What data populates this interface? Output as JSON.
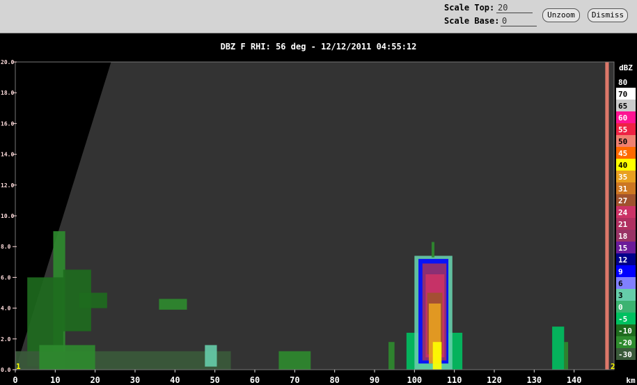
{
  "toolbar": {
    "scale_top_label": "Scale Top:",
    "scale_top_value": "20",
    "scale_base_label": "Scale Base:",
    "scale_base_value": "0",
    "unzoom_label": "Unzoom",
    "dismiss_label": "Dismiss"
  },
  "plot_title": "DBZ F  RHI: 56 deg  -  12/12/2011 04:55:12",
  "chart_data": {
    "type": "heatmap",
    "title": "DBZ F  RHI: 56 deg  -  12/12/2011 04:55:12",
    "x_axis": {
      "unit_label": "km",
      "range": [
        0,
        150
      ],
      "ticks": [
        "0",
        "10",
        "20",
        "30",
        "40",
        "50",
        "60",
        "70",
        "80",
        "90",
        "100",
        "110",
        "120",
        "130",
        "140"
      ]
    },
    "y_axis": {
      "range": [
        0,
        20
      ],
      "ticks": [
        "0.0",
        "2.0",
        "4.0",
        "6.0",
        "8.0",
        "10.0",
        "12.0",
        "14.0",
        "16.0",
        "18.0",
        "20.0"
      ]
    },
    "markers": {
      "left": "1",
      "right": "2"
    },
    "colorbar": {
      "title": "dBZ",
      "entries": [
        {
          "label": "80",
          "color": "#000000"
        },
        {
          "label": "70",
          "color": "#ffffff"
        },
        {
          "label": "65",
          "color": "#cccccc"
        },
        {
          "label": "60",
          "color": "#ff1493"
        },
        {
          "label": "55",
          "color": "#ee2244"
        },
        {
          "label": "50",
          "color": "#f08070"
        },
        {
          "label": "45",
          "color": "#ff6a00"
        },
        {
          "label": "40",
          "color": "#ffff00"
        },
        {
          "label": "35",
          "color": "#e8a020"
        },
        {
          "label": "31",
          "color": "#cc7722"
        },
        {
          "label": "27",
          "color": "#a0522d"
        },
        {
          "label": "24",
          "color": "#cc3366"
        },
        {
          "label": "21",
          "color": "#b03060"
        },
        {
          "label": "18",
          "color": "#993366"
        },
        {
          "label": "15",
          "color": "#6a1b9a"
        },
        {
          "label": "12",
          "color": "#00008b"
        },
        {
          "label": "9",
          "color": "#0000ff"
        },
        {
          "label": "6",
          "color": "#8080ff"
        },
        {
          "label": "3",
          "color": "#66cdaa"
        },
        {
          "label": "0",
          "color": "#3cb371"
        },
        {
          "label": "-5",
          "color": "#00c060"
        },
        {
          "label": "-10",
          "color": "#1e6b1e"
        },
        {
          "label": "-20",
          "color": "#2e8b2e"
        },
        {
          "label": "-30",
          "color": "#3a5a3a"
        }
      ]
    },
    "cells": [
      {
        "x": 0.0,
        "x2": 24.0,
        "y": 0.0,
        "y2": 20.0,
        "shape": "blind_wedge",
        "color": "#000000"
      },
      {
        "x": 9.5,
        "x2": 12.5,
        "y": 0.0,
        "y2": 9.0,
        "color": "#2e8b2e"
      },
      {
        "x": 3.0,
        "x2": 12.0,
        "y": 0.2,
        "y2": 6.0,
        "color": "#1e6b1e"
      },
      {
        "x": 12.0,
        "x2": 19.0,
        "y": 2.5,
        "y2": 6.5,
        "color": "#1e6b1e"
      },
      {
        "x": 16.0,
        "x2": 23.0,
        "y": 4.0,
        "y2": 5.0,
        "color": "#1e6b1e"
      },
      {
        "x": 36.0,
        "x2": 43.0,
        "y": 3.9,
        "y2": 4.6,
        "color": "#2e8b2e"
      },
      {
        "x": 0.0,
        "x2": 54.0,
        "y": 0.0,
        "y2": 1.2,
        "color": "#3a5a3a"
      },
      {
        "x": 6.0,
        "x2": 20.0,
        "y": 0.0,
        "y2": 1.6,
        "color": "#2e8b2e"
      },
      {
        "x": 47.5,
        "x2": 50.5,
        "y": 0.2,
        "y2": 1.6,
        "color": "#66cdaa"
      },
      {
        "x": 66.0,
        "x2": 74.0,
        "y": 0.0,
        "y2": 1.2,
        "color": "#2e8b2e"
      },
      {
        "x": 93.5,
        "x2": 95.0,
        "y": 0.0,
        "y2": 1.8,
        "color": "#2e8b2e"
      },
      {
        "x": 98.0,
        "x2": 112.0,
        "y": 0.0,
        "y2": 2.4,
        "color": "#00c060"
      },
      {
        "x": 100.0,
        "x2": 109.5,
        "y": 0.0,
        "y2": 7.4,
        "color": "#66cdaa"
      },
      {
        "x": 101.0,
        "x2": 108.5,
        "y": 0.4,
        "y2": 7.2,
        "color": "#0000ff"
      },
      {
        "x": 102.0,
        "x2": 108.0,
        "y": 0.6,
        "y2": 6.9,
        "color": "#993366"
      },
      {
        "x": 102.8,
        "x2": 107.5,
        "y": 0.8,
        "y2": 6.2,
        "color": "#cc3366"
      },
      {
        "x": 103.2,
        "x2": 107.0,
        "y": 1.0,
        "y2": 5.0,
        "color": "#a0522d"
      },
      {
        "x": 103.6,
        "x2": 106.6,
        "y": 0.4,
        "y2": 4.3,
        "color": "#e8a020"
      },
      {
        "x": 104.6,
        "x2": 106.8,
        "y": 0.0,
        "y2": 1.8,
        "color": "#ffff00"
      },
      {
        "x": 104.3,
        "x2": 105.0,
        "y": 7.3,
        "y2": 8.3,
        "color": "#2e8b2e"
      },
      {
        "x": 134.5,
        "x2": 137.5,
        "y": 0.0,
        "y2": 2.8,
        "color": "#00c060"
      },
      {
        "x": 137.5,
        "x2": 138.5,
        "y": 0.0,
        "y2": 1.8,
        "color": "#2e8b2e"
      },
      {
        "x": 147.8,
        "x2": 148.7,
        "y": 0.0,
        "y2": 20.0,
        "color": "#f08070"
      }
    ]
  }
}
